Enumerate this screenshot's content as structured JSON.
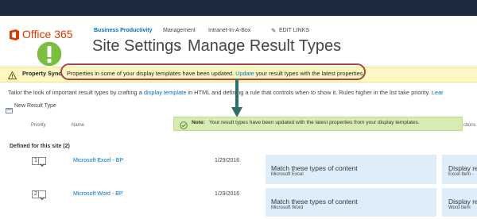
{
  "brand": {
    "name": "Office 365",
    "accent": "#d83b01"
  },
  "nav": {
    "items": [
      "Business Productivity",
      "Management",
      "Intranet-In-A-Box"
    ],
    "edit_links": "EDIT LINKS"
  },
  "page": {
    "title": "Site Settings",
    "separator": "›",
    "subtitle": "Manage Result Types"
  },
  "warning": {
    "label": "Property Sync",
    "message_start": "Properties in some of your display templates have been updated.",
    "link": "Update",
    "message_end": "your result types with the latest properties."
  },
  "description": {
    "start": "Tailor the look of important result types by crafting a",
    "link": "display template",
    "middle": "in HTML and defining a rule that controls when to show it. Rules higher in the list take priority.",
    "link2": "Lear"
  },
  "new_result_type": "New Result Type",
  "note": {
    "label": "Note:",
    "message": "Your result types have been updated with the latest properties from your display templates."
  },
  "table": {
    "headers": {
      "priority": "Priority",
      "name": "Name",
      "actions": "ctions"
    },
    "group": "Defined for this site (2)",
    "rows": [
      {
        "priority": "1",
        "name": "Microsoft Excel - BP",
        "date": "1/29/2016",
        "match_title": "Match these types of content",
        "match_sub": "Microsoft Excel",
        "display_title": "Display re",
        "display_sub": "Excel Item -"
      },
      {
        "priority": "2",
        "name": "Microsoft Word - BP",
        "date": "1/29/2016",
        "match_title": "Match these types of content",
        "match_sub": "Microsoft Word",
        "display_title": "Display re",
        "display_sub": "Word Item"
      }
    ]
  },
  "colors": {
    "warning_bg": "#fdf8c3",
    "note_bg": "#d7ecb3",
    "callout_green": "#7cbe3f",
    "arrow": "#2e6f6a",
    "highlight_ring": "#a94442"
  }
}
